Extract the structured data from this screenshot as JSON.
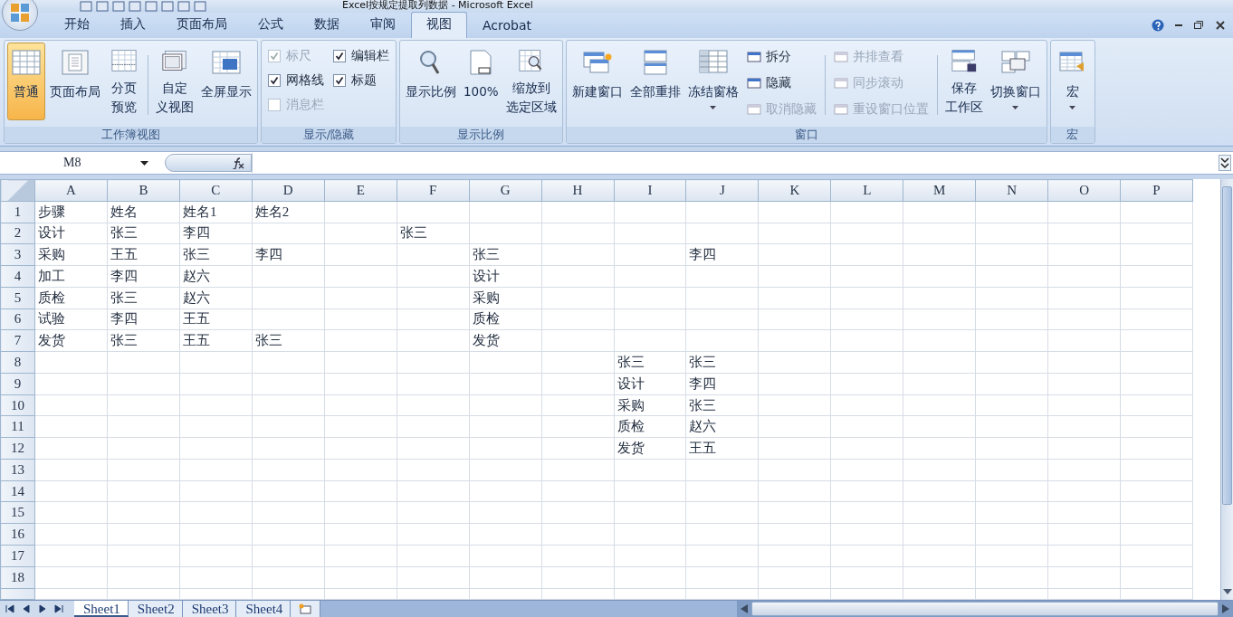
{
  "window": {
    "title": "Excel按规定提取列数据 - Microsoft Excel"
  },
  "tabs": [
    {
      "label": "开始",
      "selected": false
    },
    {
      "label": "插入",
      "selected": false
    },
    {
      "label": "页面布局",
      "selected": false
    },
    {
      "label": "公式",
      "selected": false
    },
    {
      "label": "数据",
      "selected": false
    },
    {
      "label": "审阅",
      "selected": false
    },
    {
      "label": "视图",
      "selected": true
    },
    {
      "label": "Acrobat",
      "selected": false
    }
  ],
  "ribbon": {
    "groups": [
      {
        "label": "工作簿视图",
        "items": [
          {
            "kind": "large",
            "lines": [
              "普通"
            ],
            "selected": true
          },
          {
            "kind": "large",
            "lines": [
              "页面布局"
            ],
            "selected": false
          },
          {
            "kind": "large",
            "lines": [
              "分页",
              "预览"
            ],
            "selected": false
          },
          {
            "kind": "separator"
          },
          {
            "kind": "large",
            "lines": [
              "自定",
              "义视图"
            ],
            "selected": false
          },
          {
            "kind": "large",
            "lines": [
              "全屏显示"
            ],
            "selected": false
          }
        ]
      },
      {
        "label": "显示/隐藏",
        "items": [
          {
            "kind": "column",
            "items": [
              {
                "kind": "check",
                "label": "标尺",
                "checked": true,
                "disabled": true
              },
              {
                "kind": "check",
                "label": "网格线",
                "checked": true,
                "disabled": false
              },
              {
                "kind": "check",
                "label": "消息栏",
                "checked": false,
                "disabled": true
              }
            ]
          },
          {
            "kind": "column",
            "items": [
              {
                "kind": "check",
                "label": "编辑栏",
                "checked": true,
                "disabled": false
              },
              {
                "kind": "check",
                "label": "标题",
                "checked": true,
                "disabled": false
              }
            ]
          }
        ]
      },
      {
        "label": "显示比例",
        "items": [
          {
            "kind": "large",
            "lines": [
              "显示比例"
            ],
            "selected": false
          },
          {
            "kind": "large",
            "lines": [
              "100%"
            ],
            "selected": false
          },
          {
            "kind": "large",
            "lines": [
              "缩放到",
              "选定区域"
            ],
            "selected": false
          }
        ]
      },
      {
        "label": "窗口",
        "items": [
          {
            "kind": "large",
            "lines": [
              "新建窗口"
            ],
            "selected": false
          },
          {
            "kind": "large",
            "lines": [
              "全部重排"
            ],
            "selected": false
          },
          {
            "kind": "large",
            "lines": [
              "冻结窗格"
            ],
            "selected": false,
            "dropdown": true
          },
          {
            "kind": "column",
            "items": [
              {
                "kind": "small",
                "label": "拆分",
                "disabled": false
              },
              {
                "kind": "small",
                "label": "隐藏",
                "disabled": false
              },
              {
                "kind": "small",
                "label": "取消隐藏",
                "disabled": true
              }
            ]
          },
          {
            "kind": "separator"
          },
          {
            "kind": "column",
            "items": [
              {
                "kind": "small",
                "label": "并排查看",
                "disabled": true
              },
              {
                "kind": "small",
                "label": "同步滚动",
                "disabled": true
              },
              {
                "kind": "small",
                "label": "重设窗口位置",
                "disabled": true
              }
            ]
          },
          {
            "kind": "separator"
          },
          {
            "kind": "large",
            "lines": [
              "保存",
              "工作区"
            ],
            "selected": false
          },
          {
            "kind": "large",
            "lines": [
              "切换窗口"
            ],
            "selected": false,
            "dropdown": true
          }
        ]
      },
      {
        "label": "宏",
        "items": [
          {
            "kind": "large",
            "lines": [
              "宏"
            ],
            "selected": false,
            "dropdown": true
          }
        ]
      }
    ]
  },
  "formula_bar": {
    "name_box": "M8"
  },
  "sheet": {
    "columns": [
      "A",
      "B",
      "C",
      "D",
      "E",
      "F",
      "G",
      "H",
      "I",
      "J",
      "K",
      "L",
      "M",
      "N",
      "O",
      "P"
    ],
    "rows": [
      {
        "number": "1",
        "cells": [
          "步骤",
          "姓名",
          "姓名1",
          "姓名2"
        ]
      },
      {
        "number": "2",
        "cells": [
          "设计",
          "张三",
          "李四",
          null,
          null,
          "张三"
        ]
      },
      {
        "number": "3",
        "cells": [
          "采购",
          "王五",
          "张三",
          "李四",
          null,
          null,
          "张三",
          null,
          null,
          "李四"
        ]
      },
      {
        "number": "4",
        "cells": [
          "加工",
          "李四",
          "赵六",
          null,
          null,
          null,
          "设计"
        ]
      },
      {
        "number": "5",
        "cells": [
          "质检",
          "张三",
          "赵六",
          null,
          null,
          null,
          "采购"
        ]
      },
      {
        "number": "6",
        "cells": [
          "试验",
          "李四",
          "王五",
          null,
          null,
          null,
          "质检"
        ]
      },
      {
        "number": "7",
        "cells": [
          "发货",
          "张三",
          "王五",
          "张三",
          null,
          null,
          "发货"
        ]
      },
      {
        "number": "8",
        "cells": [
          null,
          null,
          null,
          null,
          null,
          null,
          null,
          null,
          "张三",
          "张三"
        ]
      },
      {
        "number": "9",
        "cells": [
          null,
          null,
          null,
          null,
          null,
          null,
          null,
          null,
          "设计",
          "李四"
        ]
      },
      {
        "number": "10",
        "cells": [
          null,
          null,
          null,
          null,
          null,
          null,
          null,
          null,
          "采购",
          "张三"
        ]
      },
      {
        "number": "11",
        "cells": [
          null,
          null,
          null,
          null,
          null,
          null,
          null,
          null,
          "质检",
          "赵六"
        ]
      },
      {
        "number": "12",
        "cells": [
          null,
          null,
          null,
          null,
          null,
          null,
          null,
          null,
          "发货",
          "王五"
        ]
      },
      {
        "number": "13"
      },
      {
        "number": "14"
      },
      {
        "number": "15"
      },
      {
        "number": "16"
      },
      {
        "number": "17"
      },
      {
        "number": "18"
      }
    ]
  },
  "sheet_tabs": [
    {
      "label": "Sheet1",
      "selected": true
    },
    {
      "label": "Sheet2",
      "selected": false
    },
    {
      "label": "Sheet3",
      "selected": false
    },
    {
      "label": "Sheet4",
      "selected": false
    }
  ]
}
